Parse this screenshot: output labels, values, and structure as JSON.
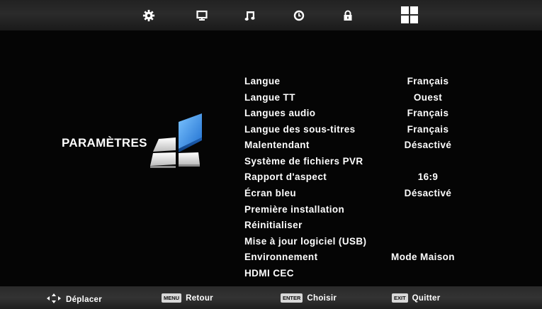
{
  "top_menu": {
    "icons": [
      {
        "name": "settings-gear-icon",
        "active": true
      },
      {
        "name": "monitor-icon",
        "active": false
      },
      {
        "name": "music-note-icon",
        "active": false
      },
      {
        "name": "clock-icon",
        "active": false
      },
      {
        "name": "lock-icon",
        "active": false
      },
      {
        "name": "apps-grid-icon",
        "active": false
      }
    ]
  },
  "page": {
    "title": "PARAMÈTRES"
  },
  "menu": {
    "items": [
      {
        "label": "Langue",
        "value": "Français"
      },
      {
        "label": "Langue TT",
        "value": "Ouest"
      },
      {
        "label": "Langues audio",
        "value": "Français"
      },
      {
        "label": "Langue des sous-titres",
        "value": "Français"
      },
      {
        "label": "Malentendant",
        "value": "Désactivé"
      },
      {
        "label": "Système de fichiers PVR",
        "value": ""
      },
      {
        "label": "Rapport d'aspect",
        "value": "16:9"
      },
      {
        "label": "Écran bleu",
        "value": "Désactivé"
      },
      {
        "label": "Première installation",
        "value": ""
      },
      {
        "label": "Réinitialiser",
        "value": ""
      },
      {
        "label": "Mise à jour logiciel (USB)",
        "value": ""
      },
      {
        "label": "Environnement",
        "value": "Mode Maison"
      },
      {
        "label": "HDMI CEC",
        "value": ""
      }
    ]
  },
  "bottom_bar": {
    "move": {
      "text": "Déplacer",
      "icon": "navigation-arrows-icon"
    },
    "back": {
      "key": "MENU",
      "text": "Retour"
    },
    "select": {
      "key": "ENTER",
      "text": "Choisir"
    },
    "exit": {
      "key": "EXIT",
      "text": "Quitter"
    }
  },
  "colors": {
    "background": "#050505",
    "bar": "#2b2b2b",
    "text": "#ffffff",
    "logo_blue": "#2a86de",
    "logo_white": "#e6e6e6"
  }
}
